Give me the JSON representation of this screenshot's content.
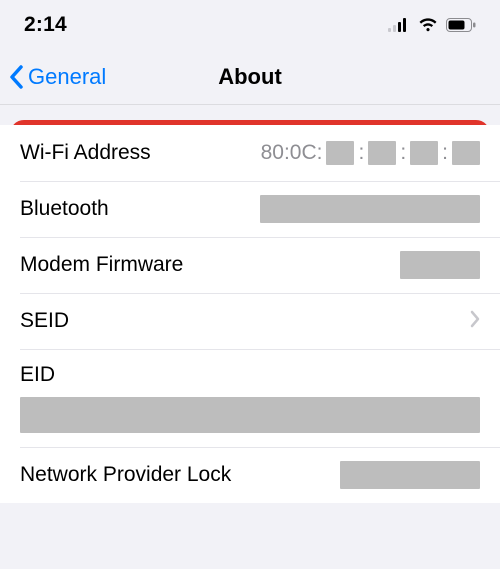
{
  "status": {
    "time": "2:14"
  },
  "nav": {
    "back_label": "General",
    "title": "About"
  },
  "rows": {
    "wifi_label": "Wi-Fi Address",
    "wifi_prefix": "80:0C:",
    "wifi_colon": ":",
    "bluetooth_label": "Bluetooth",
    "modem_label": "Modem Firmware",
    "seid_label": "SEID",
    "eid_label": "EID",
    "npl_label": "Network Provider Lock"
  }
}
